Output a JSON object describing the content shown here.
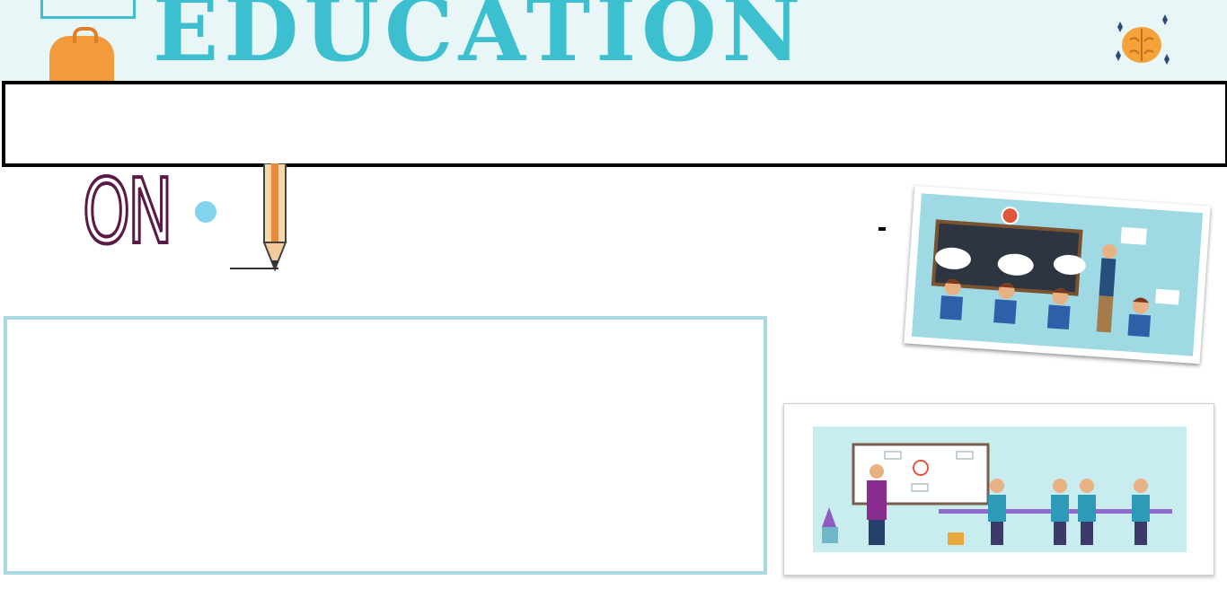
{
  "banner": {
    "title": "EDUCATION"
  },
  "headline": {
    "text": ""
  },
  "subtitle": {
    "word": "ON"
  },
  "content": {
    "text": ""
  },
  "colors": {
    "banner_text": "#3cc0cf",
    "on_outline": "#5a1a48",
    "content_border": "#a8dae2",
    "dot": "#82d4ee"
  },
  "images": [
    {
      "name": "classroom-illustration"
    },
    {
      "name": "lecture-illustration"
    }
  ]
}
